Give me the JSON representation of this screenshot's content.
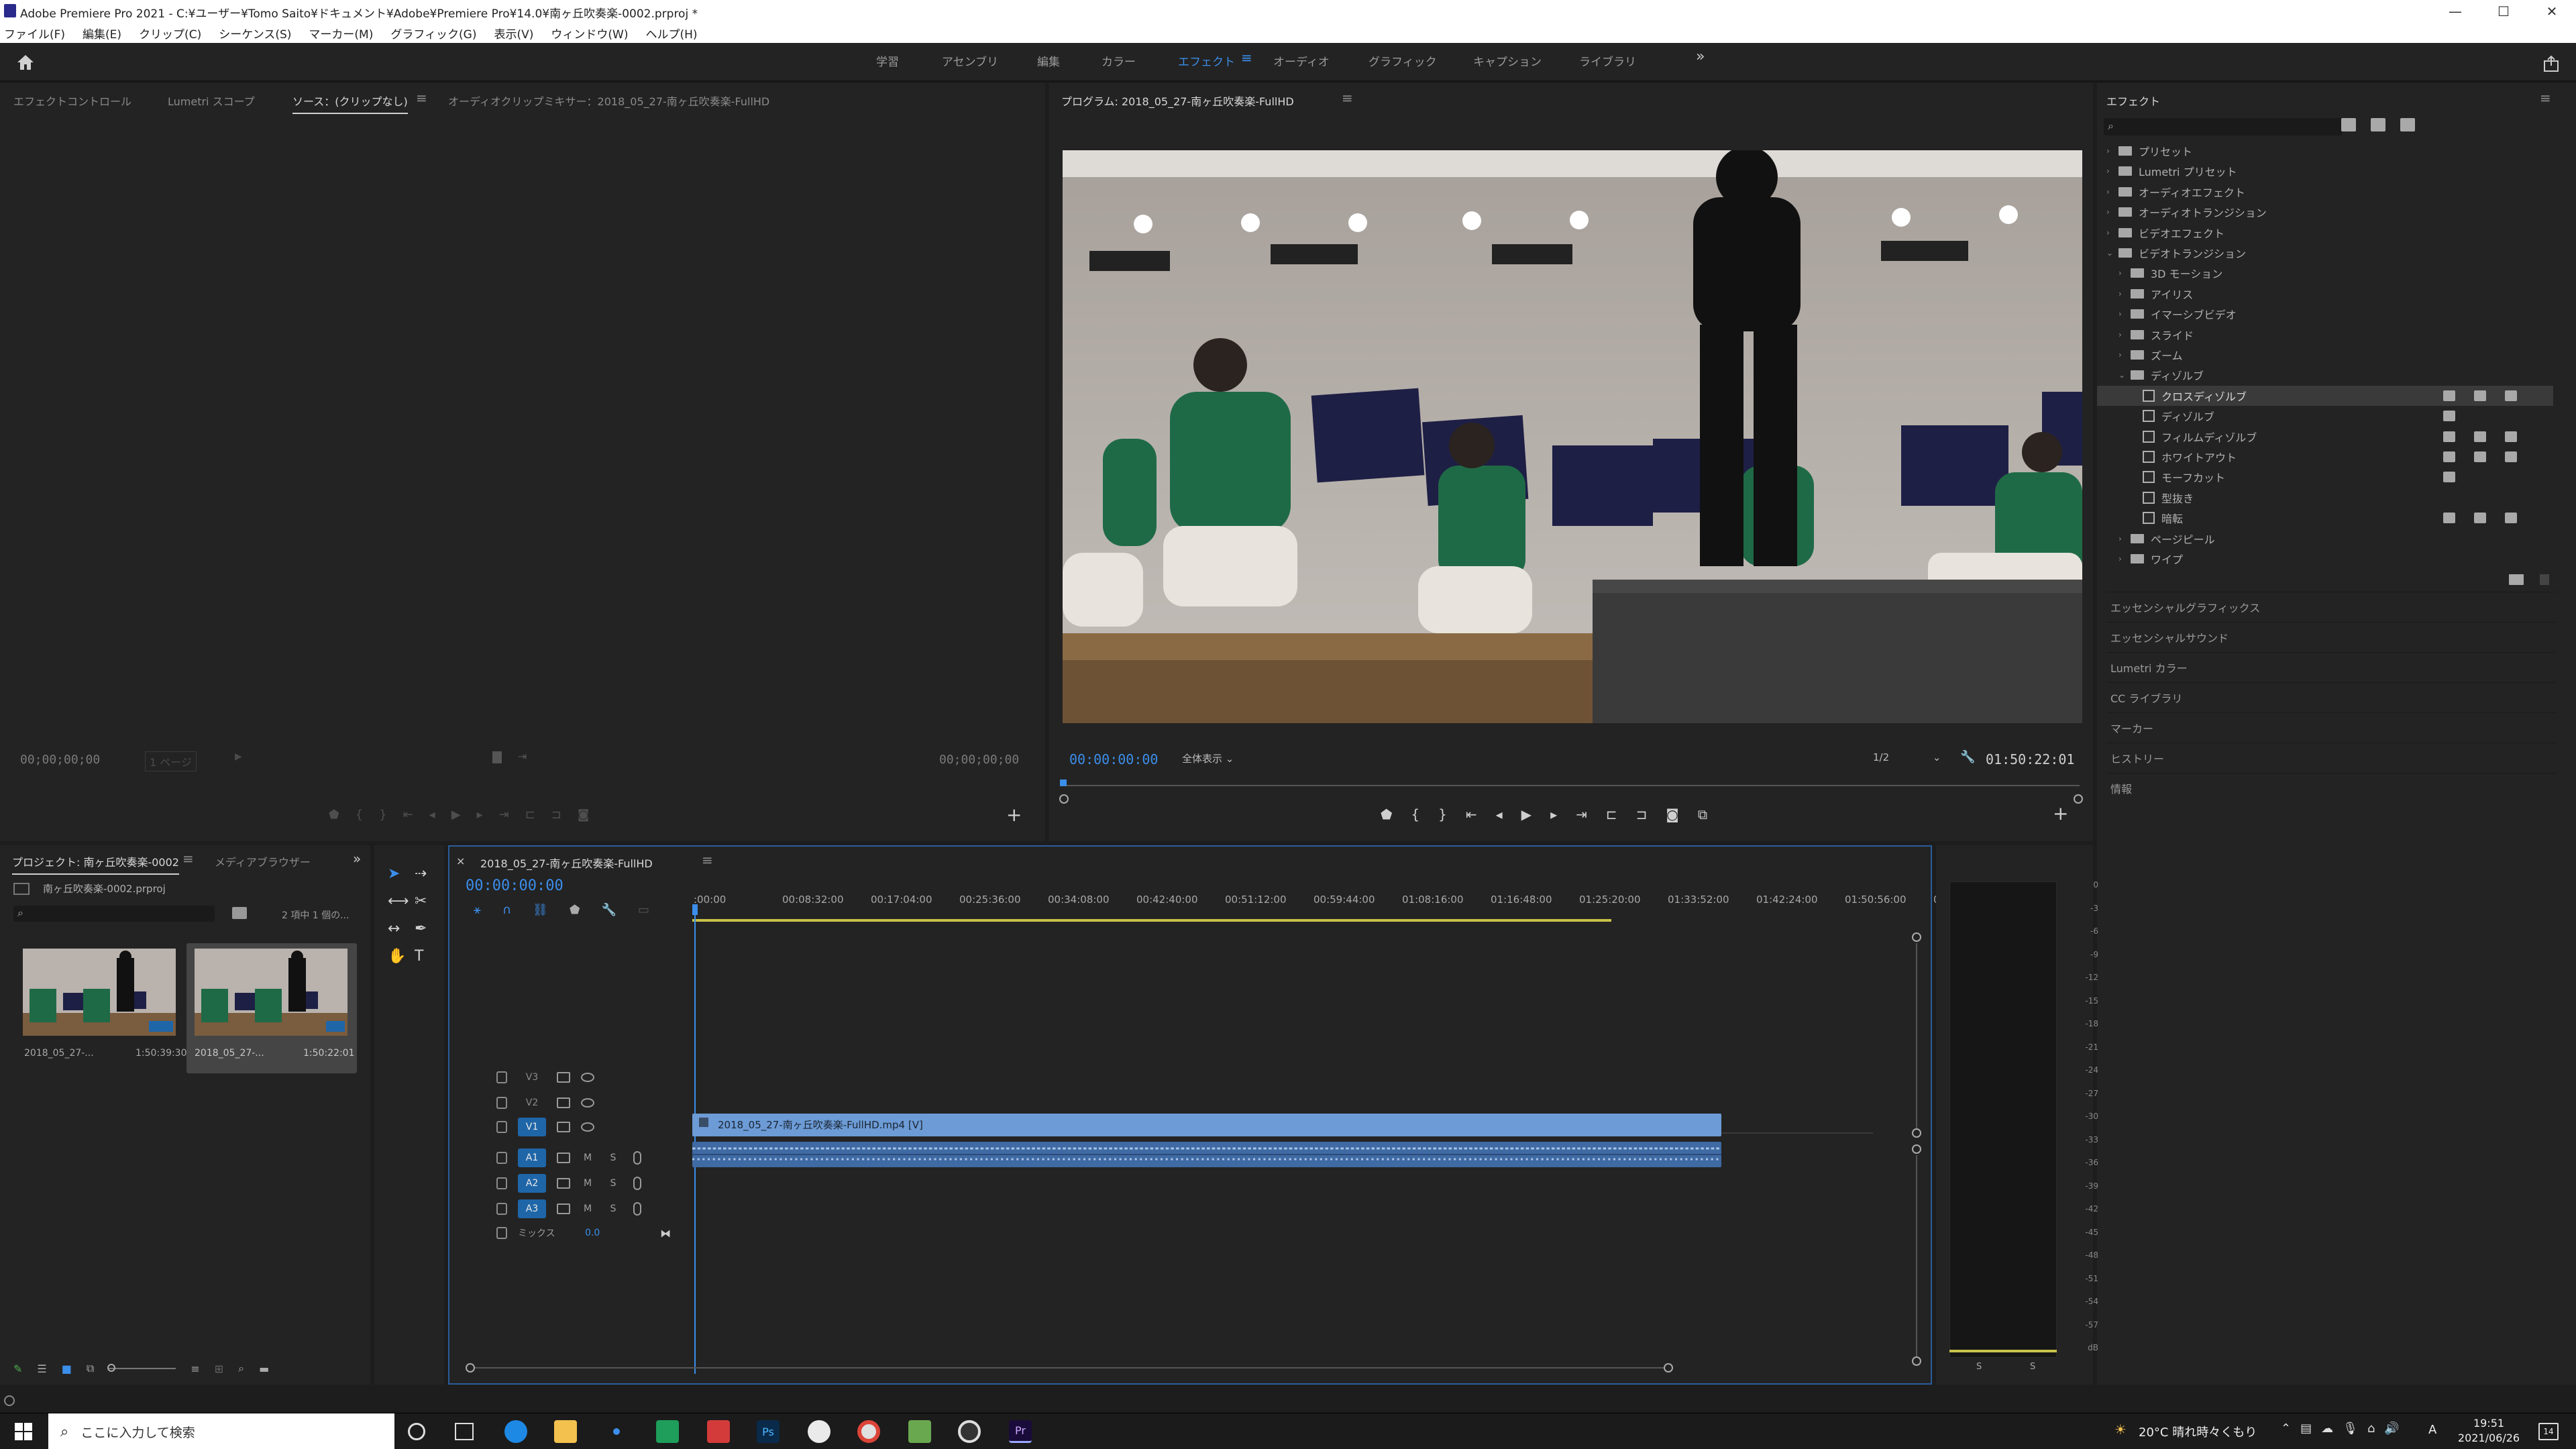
{
  "window": {
    "title": "Adobe Premiere Pro 2021 - C:¥ユーザー¥Tomo Saito¥ドキュメント¥Adobe¥Premiere Pro¥14.0¥南ヶ丘吹奏楽-0002.prproj *",
    "minimize": "—",
    "maximize": "☐",
    "close": "✕"
  },
  "menu": [
    "ファイル(F)",
    "編集(E)",
    "クリップ(C)",
    "シーケンス(S)",
    "マーカー(M)",
    "グラフィック(G)",
    "表示(V)",
    "ウィンドウ(W)",
    "ヘルプ(H)"
  ],
  "workspaces": [
    "学習",
    "アセンブリ",
    "編集",
    "カラー",
    "エフェクト",
    "オーディオ",
    "グラフィック",
    "キャプション",
    "ライブラリ"
  ],
  "workspace_active_index": 4,
  "source_panel": {
    "tabs": [
      "エフェクトコントロール",
      "Lumetri スコープ",
      "ソース：(クリップなし)",
      "オーディオクリップミキサー：2018_05_27-南ヶ丘吹奏楽-FullHD"
    ],
    "active_tab_index": 2,
    "timecode_left": "00;00;00;00",
    "page_indicator": "1 ページ",
    "timecode_right": "00;00;00;00"
  },
  "program_panel": {
    "title": "プログラム: 2018_05_27-南ヶ丘吹奏楽-FullHD",
    "timecode": "00:00:00:00",
    "fit": "全体表示",
    "resolution": "1/2",
    "duration": "01:50:22:01"
  },
  "effects_panel": {
    "title": "エフェクト",
    "tree": [
      {
        "label": "プリセット",
        "level": 0,
        "expanded": false
      },
      {
        "label": "Lumetri プリセット",
        "level": 0,
        "expanded": false
      },
      {
        "label": "オーディオエフェクト",
        "level": 0,
        "expanded": false
      },
      {
        "label": "オーディオトランジション",
        "level": 0,
        "expanded": false
      },
      {
        "label": "ビデオエフェクト",
        "level": 0,
        "expanded": false
      },
      {
        "label": "ビデオトランジション",
        "level": 0,
        "expanded": true
      },
      {
        "label": "3D モーション",
        "level": 1,
        "expanded": false
      },
      {
        "label": "アイリス",
        "level": 1,
        "expanded": false
      },
      {
        "label": "イマーシブビデオ",
        "level": 1,
        "expanded": false
      },
      {
        "label": "スライド",
        "level": 1,
        "expanded": false
      },
      {
        "label": "ズーム",
        "level": 1,
        "expanded": false
      },
      {
        "label": "ディゾルブ",
        "level": 1,
        "expanded": true
      },
      {
        "label": "クロスディゾルブ",
        "level": 2,
        "selected": true,
        "badges": 3
      },
      {
        "label": "ディゾルブ",
        "level": 2,
        "badges": 1
      },
      {
        "label": "フィルムディゾルブ",
        "level": 2,
        "badges": 3
      },
      {
        "label": "ホワイトアウト",
        "level": 2,
        "badges": 3
      },
      {
        "label": "モーフカット",
        "level": 2,
        "badges": 1
      },
      {
        "label": "型抜き",
        "level": 2,
        "badges": 0
      },
      {
        "label": "暗転",
        "level": 2,
        "badges": 3
      },
      {
        "label": "ページピール",
        "level": 1,
        "expanded": false
      },
      {
        "label": "ワイプ",
        "level": 1,
        "expanded": false
      }
    ],
    "collapsed_panels": [
      "エッセンシャルグラフィックス",
      "エッセンシャルサウンド",
      "Lumetri カラー",
      "CC ライブラリ",
      "マーカー",
      "ヒストリー",
      "情報"
    ]
  },
  "project_panel": {
    "tabs": [
      "プロジェクト: 南ヶ丘吹奏楽-0002",
      "メディアブラウザー"
    ],
    "file": "南ヶ丘吹奏楽-0002.prproj",
    "selection": "2 項中 1 個の...",
    "clips": [
      {
        "name": "2018_05_27-...",
        "duration": "1:50:39:30"
      },
      {
        "name": "2018_05_27-...",
        "duration": "1:50:22:01"
      }
    ]
  },
  "timeline": {
    "tab": "2018_05_27-南ヶ丘吹奏楽-FullHD",
    "timecode": "00:00:00:00",
    "ruler": [
      ":00:00",
      "00:08:32:00",
      "00:17:04:00",
      "00:25:36:00",
      "00:34:08:00",
      "00:42:40:00",
      "00:51:12:00",
      "00:59:44:00",
      "01:08:16:00",
      "01:16:48:00",
      "01:25:20:00",
      "01:33:52:00",
      "01:42:24:00",
      "01:50:56:00",
      "01"
    ],
    "video_tracks": [
      "V3",
      "V2",
      "V1"
    ],
    "audio_tracks": [
      "A1",
      "A2",
      "A3"
    ],
    "mix_label": "ミックス",
    "mix_value": "0.0",
    "clip_label": "2018_05_27-南ヶ丘吹奏楽-FullHD.mp4 [V]",
    "clip_fraction": 0.845,
    "mute": "M",
    "solo": "S"
  },
  "audio_meter": {
    "scale": [
      "0",
      "-3",
      "-6",
      "-9",
      "-12",
      "-15",
      "-18",
      "-21",
      "-24",
      "-27",
      "-30",
      "-33",
      "-36",
      "-39",
      "-42",
      "-45",
      "-48",
      "-51",
      "-54",
      "-57",
      "dB"
    ],
    "footer": [
      "S",
      "S"
    ]
  },
  "taskbar": {
    "search_placeholder": "ここに入力して検索",
    "weather": "20°C 晴れ時々くもり",
    "ime": "A",
    "time": "19:51",
    "date": "2021/06/26",
    "notifications": "14"
  },
  "colors": {
    "accent": "#3b8eea",
    "panel": "#232323",
    "clip": "#6c9bd6",
    "selected_track": "#1f66a8"
  }
}
